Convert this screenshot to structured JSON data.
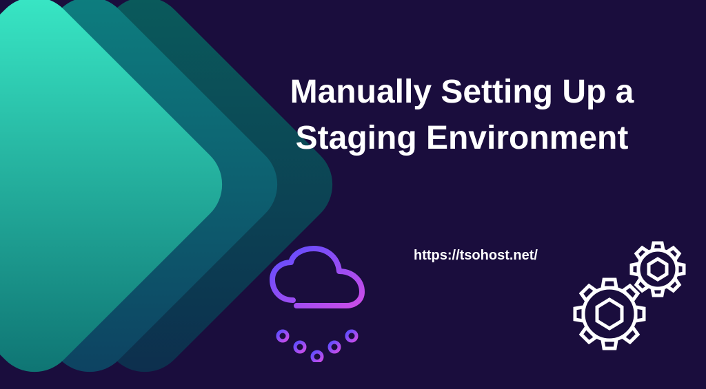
{
  "title": "Manually Setting Up a Staging Environment",
  "url": "https://tsohost.net/",
  "colors": {
    "background": "#1a0d3d",
    "text": "#ffffff",
    "arrow_gradient_start": "#3aebc8",
    "arrow_gradient_end": "#0d7070",
    "cloud_gradient_start": "#5b4dff",
    "cloud_gradient_end": "#cc4de8"
  },
  "icons": {
    "cloud": "cloud-network-icon",
    "gears": "settings-gears-icon"
  }
}
